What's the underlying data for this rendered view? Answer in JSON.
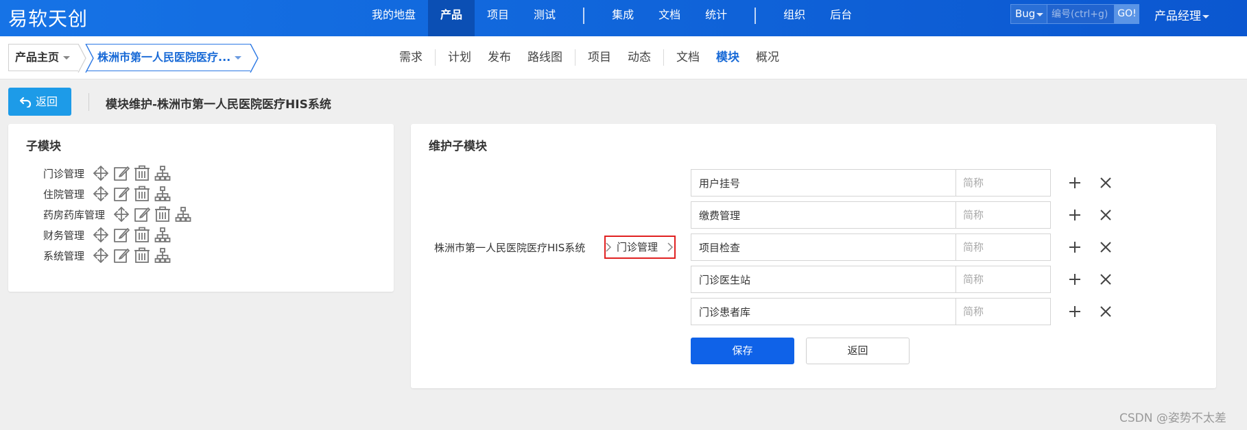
{
  "brand": "易软天创",
  "main_nav": {
    "group1": [
      "我的地盘",
      "产品",
      "项目",
      "测试"
    ],
    "group2": [
      "集成",
      "文档",
      "统计"
    ],
    "group3": [
      "组织",
      "后台"
    ],
    "active": "产品"
  },
  "search": {
    "type": "Bug",
    "placeholder": "编号(ctrl+g)",
    "go_label": "GO!"
  },
  "user": {
    "role": "产品经理"
  },
  "breadcrumb": {
    "home": "产品主页",
    "product": "株洲市第一人民医院医疗..."
  },
  "sub_nav": {
    "group1": [
      "需求"
    ],
    "group2": [
      "计划",
      "发布",
      "路线图"
    ],
    "group3": [
      "项目",
      "动态"
    ],
    "group4": [
      "文档",
      "模块",
      "概况"
    ],
    "active": "模块"
  },
  "back_button": {
    "label": "返回"
  },
  "page_title": "模块维护-株洲市第一人民医院医疗HIS系统",
  "left_panel": {
    "title": "子模块",
    "modules": [
      "门诊管理",
      "住院管理",
      "药房药库管理",
      "财务管理",
      "系统管理"
    ]
  },
  "right_panel": {
    "title": "维护子模块",
    "path_root": "株洲市第一人民医院医疗HIS系统",
    "path_current": "门诊管理",
    "submodules": [
      {
        "name": "用户挂号",
        "short_placeholder": "简称"
      },
      {
        "name": "缴费管理",
        "short_placeholder": "简称"
      },
      {
        "name": "项目检查",
        "short_placeholder": "简称"
      },
      {
        "name": "门诊医生站",
        "short_placeholder": "简称"
      },
      {
        "name": "门诊患者库",
        "short_placeholder": "简称"
      }
    ],
    "save_label": "保存",
    "back_label": "返回"
  },
  "watermark": "CSDN @姿势不太差",
  "colors": {
    "primary": "#0f62e8",
    "topbar": "#1673e6",
    "accent_text": "#1769d6",
    "back_button": "#1d9be8",
    "highlight_border": "#e02020"
  },
  "icons": {
    "module_actions": [
      "move-icon",
      "edit-icon",
      "delete-icon",
      "hierarchy-icon"
    ],
    "row_actions": [
      "plus-icon",
      "close-icon"
    ]
  }
}
